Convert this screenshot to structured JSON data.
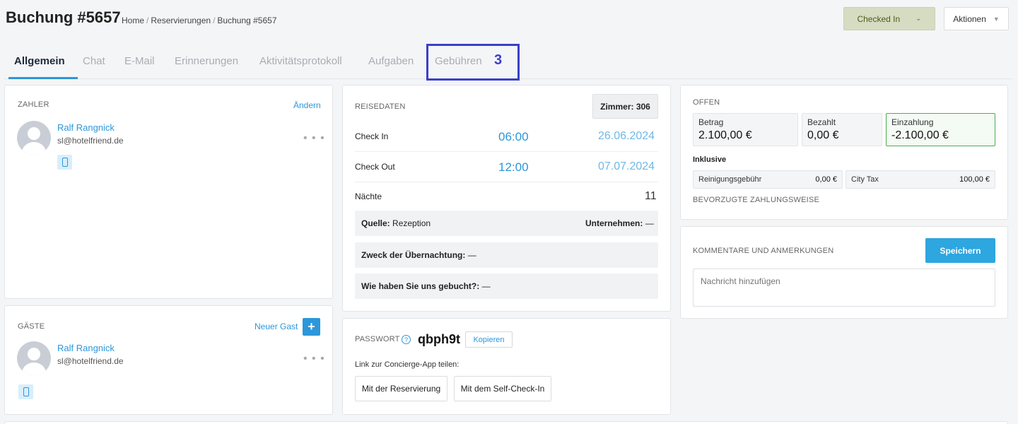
{
  "header": {
    "title": "Buchung #5657",
    "breadcrumb": [
      "Home",
      "Reservierungen",
      "Buchung #5657"
    ],
    "status_button": "Checked In",
    "actions_button": "Aktionen"
  },
  "tabs": [
    {
      "label": "Allgemein",
      "active": true
    },
    {
      "label": "Chat"
    },
    {
      "label": "E-Mail"
    },
    {
      "label": "Erinnerungen"
    },
    {
      "label": "Aktivitätsprotokoll"
    },
    {
      "label": "Aufgaben"
    },
    {
      "label": "Gebühren"
    }
  ],
  "annotation_number": "3",
  "payer": {
    "title": "ZAHLER",
    "change_link": "Ändern",
    "name": "Ralf Rangnick",
    "email": "sl@hotelfriend.de",
    "menu": "• • •"
  },
  "guests": {
    "title": "GÄSTE",
    "new_guest_link": "Neuer Gast",
    "add_symbol": "+",
    "name": "Ralf Rangnick",
    "email": "sl@hotelfriend.de",
    "menu": "• • •"
  },
  "trip": {
    "title": "REISEDATEN",
    "room": "Zimmer: 306",
    "checkin_label": "Check In",
    "checkin_time": "06:00",
    "checkin_date": "26.06.2024",
    "checkout_label": "Check Out",
    "checkout_time": "12:00",
    "checkout_date": "07.07.2024",
    "nights_label": "Nächte",
    "nights_value": "11",
    "source_label": "Quelle:",
    "source_value": "Rezeption",
    "company_label": "Unternehmen:",
    "company_value": "—",
    "purpose_label": "Zweck der Übernachtung:",
    "purpose_value": "—",
    "howbooked_label": "Wie haben Sie uns gebucht?:",
    "howbooked_value": "—"
  },
  "password": {
    "title": "PASSWORT",
    "help_symbol": "?",
    "value": "qbph9t",
    "copy_button": "Kopieren",
    "share_text": "Link zur Concierge-App teilen:",
    "with_reservation": "Mit der Reservierung",
    "with_selfcheckin": "Mit dem Self-Check-In"
  },
  "payment": {
    "title": "OFFEN",
    "amount_label": "Betrag",
    "amount_value": "2.100,00 €",
    "paid_label": "Bezahlt",
    "paid_value": "0,00 €",
    "deposit_label": "Einzahlung",
    "deposit_value": "-2.100,00 €",
    "inclusive_label": "Inklusive",
    "fees": [
      {
        "label": "Reinigungsgebühr",
        "value": "0,00 €"
      },
      {
        "label": "City Tax",
        "value": "100,00 €"
      }
    ],
    "preferred_method_label": "BEVORZUGTE ZAHLUNGSWEISE"
  },
  "comments": {
    "title": "KOMMENTARE UND ANMERKUNGEN",
    "save_button": "Speichern",
    "placeholder": "Nachricht hinzufügen"
  },
  "colors": {
    "accent": "#2c97d9",
    "status_bg": "#d6dcc2",
    "highlight": "#3b3fc8",
    "deposit_border": "#4caf50"
  }
}
